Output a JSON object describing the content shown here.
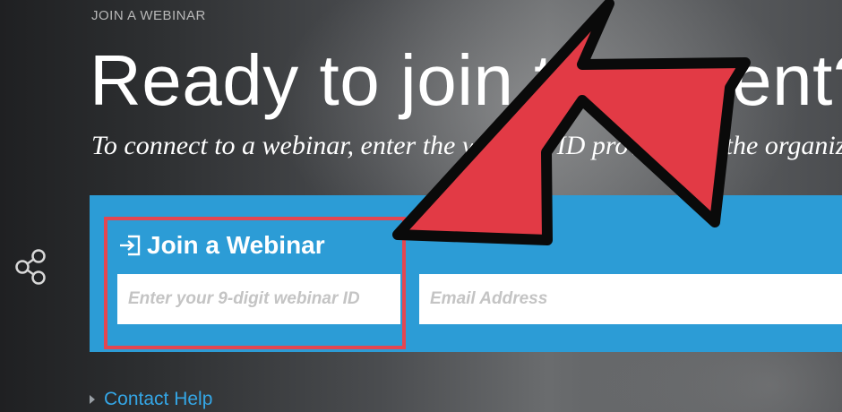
{
  "header": {
    "eyebrow": "JOIN A WEBINAR",
    "headline": "Ready to join the event?",
    "subline": "To connect to a webinar, enter the webinar ID provided by the organizer."
  },
  "join_panel": {
    "title": "Join a Webinar",
    "title_icon": "sign-in-icon",
    "webinar_id_placeholder": "Enter your 9-digit webinar ID",
    "email_placeholder": "Email Address"
  },
  "footer": {
    "contact_help": "Contact Help"
  },
  "icons": {
    "share": "share-icon",
    "arrow": "annotation-arrow"
  },
  "colors": {
    "panel_blue": "#2c9cd6",
    "highlight_red": "#e44651",
    "arrow_red": "#e23a45",
    "link_blue": "#34a6e6"
  }
}
